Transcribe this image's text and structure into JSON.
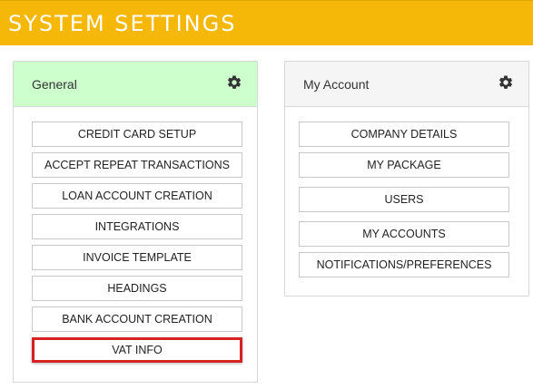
{
  "header": {
    "title": "SYSTEM SETTINGS"
  },
  "general": {
    "title": "General",
    "icon": "gear-icon",
    "buttons": [
      "CREDIT CARD SETUP",
      "ACCEPT REPEAT TRANSACTIONS",
      "LOAN ACCOUNT CREATION",
      "INTEGRATIONS",
      "INVOICE TEMPLATE",
      "HEADINGS",
      "BANK ACCOUNT CREATION",
      "VAT INFO"
    ]
  },
  "account": {
    "title": "My Account",
    "icon": "gear-icon",
    "buttons": [
      "COMPANY DETAILS",
      "MY PACKAGE",
      "USERS",
      "MY ACCOUNTS",
      "NOTIFICATIONS/PREFERENCES"
    ]
  },
  "colors": {
    "header_bg": "#f5b708",
    "general_head_bg": "#ccffcc",
    "account_head_bg": "#f5f5f5",
    "highlight": "#d62222"
  }
}
